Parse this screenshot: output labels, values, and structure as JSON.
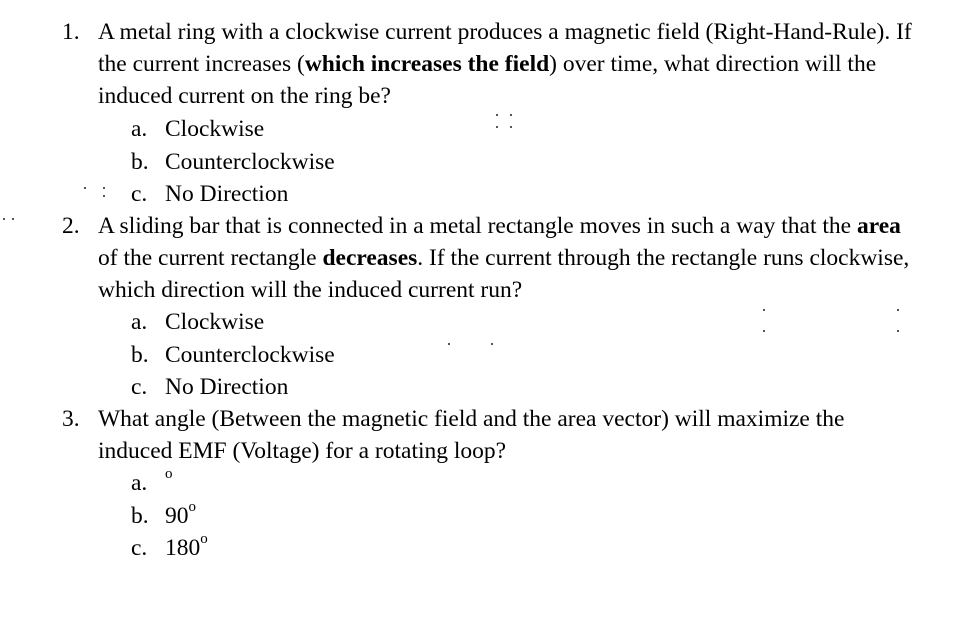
{
  "questions": [
    {
      "number": "1.",
      "text_parts": [
        {
          "t": "A metal ring with a clockwise current produces a magnetic field (Right-Hand-Rule).  If the current increases (",
          "bold": false
        },
        {
          "t": "which increases the field",
          "bold": true
        },
        {
          "t": ") over time, what direction will the induced current on the ring be?",
          "bold": false
        }
      ],
      "options": [
        {
          "letter": "a.",
          "text": "Clockwise"
        },
        {
          "letter": "b.",
          "text": "Counterclockwise"
        },
        {
          "letter": "c.",
          "text": "No Direction"
        }
      ]
    },
    {
      "number": "2.",
      "text_parts": [
        {
          "t": "A sliding bar that is connected in a metal rectangle moves in such a way that the ",
          "bold": false
        },
        {
          "t": "area",
          "bold": true
        },
        {
          "t": " of the current rectangle ",
          "bold": false
        },
        {
          "t": "decreases",
          "bold": true
        },
        {
          "t": ".  If the current through the rectangle runs clockwise, which direction will the induced current run?",
          "bold": false
        }
      ],
      "options": [
        {
          "letter": "a.",
          "text": "Clockwise"
        },
        {
          "letter": "b.",
          "text": "Counterclockwise"
        },
        {
          "letter": "c.",
          "text": "No Direction"
        }
      ]
    },
    {
      "number": "3.",
      "text_parts": [
        {
          "t": "What angle (Between the magnetic field and the area vector) will maximize the induced EMF (Voltage) for a rotating loop?",
          "bold": false
        }
      ],
      "options": [
        {
          "letter": "a.",
          "text": "",
          "sup": "o"
        },
        {
          "letter": "b.",
          "text": "90",
          "sup": "o"
        },
        {
          "letter": "c.",
          "text": "180",
          "sup": "o"
        }
      ]
    }
  ]
}
